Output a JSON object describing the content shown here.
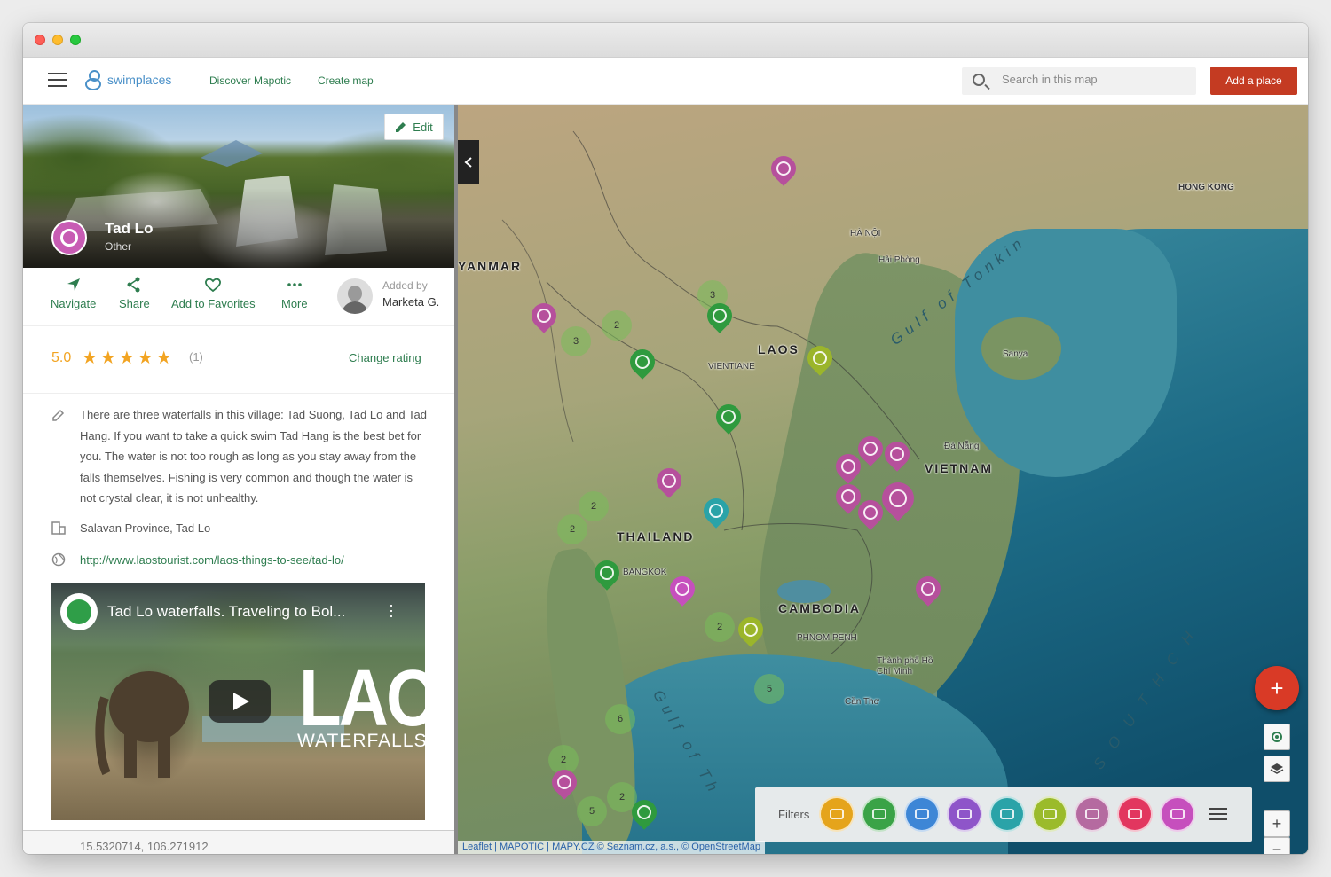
{
  "app": {
    "logo_text": "swimplaces",
    "nav": [
      "Discover Mapotic",
      "Create map"
    ],
    "search_placeholder": "Search in this map",
    "add_place_label": "Add a place"
  },
  "place": {
    "name": "Tad Lo",
    "category": "Other",
    "edit_label": "Edit",
    "actions": [
      "Navigate",
      "Share",
      "Add to Favorites",
      "More"
    ],
    "added_by_label": "Added by",
    "added_by_user": "Marketa G.",
    "rating": "5.0",
    "stars": "★★★★★",
    "rating_count": "(1)",
    "change_rating_label": "Change rating",
    "description": "There are three waterfalls in this village: Tad Suong, Tad Lo and Tad Hang. If you want to take a quick swim Tad Hang is the best bet for you. The water is not too rough as long as you stay away from the falls themselves. Fishing is very common and though the water is not crystal clear, it is not unhealthy.",
    "address": "Salavan Province, Tad Lo",
    "url": "http://www.laostourist.com/laos-things-to-see/tad-lo/",
    "coordinates": "15.5320714, 106.271912"
  },
  "video": {
    "title": "Tad Lo waterfalls. Traveling to Bol...",
    "overlay_big": "LAOS",
    "overlay_sub": "WATERFALLS"
  },
  "map": {
    "labels": {
      "myanmar": "YANMAR",
      "laos": "LAOS",
      "vietnam": "VIETNAM",
      "thailand": "THAILAND",
      "cambodia": "CAMBODIA",
      "hongkong": "HONG KONG",
      "hanoi": "HÀ NỘI",
      "haiphong": "Hải Phòng",
      "vientiane": "VIENTIANE",
      "bangkok": "BANGKOK",
      "phnompenh": "PHNOM PENH",
      "hcm": "Thành phố Hồ Chí Minh",
      "cantho": "Cần Thơ",
      "danang": "Đà Nẵng",
      "sanya": "Sanya",
      "gulf_tonkin": "Gulf of Tonkin",
      "gulf_thailand": "Gulf of Th",
      "south_sea": "S O U T H  C H"
    },
    "clusters": [
      "3",
      "2",
      "3",
      "2",
      "2",
      "2",
      "5",
      "6",
      "2",
      "2",
      "5"
    ],
    "filters_label": "Filters",
    "filter_colors": [
      "#e5a41b",
      "#3aa347",
      "#3d86d6",
      "#8e55c9",
      "#2aa3a8",
      "#9bbb2b",
      "#b56aa0",
      "#e2365f",
      "#c64fbd"
    ],
    "attribution": "Leaflet | MAPOTIC | MAPY.CZ © Seznam.cz, a.s., © OpenStreetMap"
  }
}
